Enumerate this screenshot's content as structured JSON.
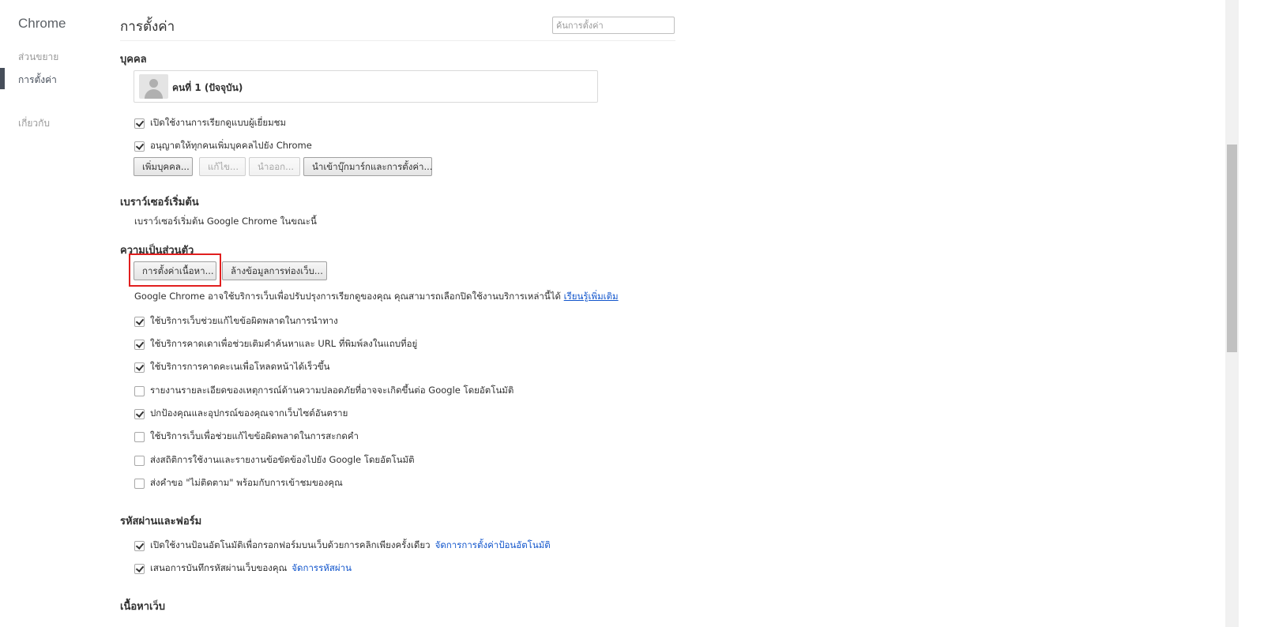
{
  "sidebar": {
    "app_title": "Chrome",
    "items": [
      {
        "label": "ส่วนขยาย"
      },
      {
        "label": "การตั้งค่า"
      },
      {
        "label": "เกี่ยวกับ"
      }
    ]
  },
  "header": {
    "title": "การตั้งค่า",
    "search_placeholder": "ค้นการตั้งค่า"
  },
  "people": {
    "title": "บุคคล",
    "profile_name": "คนที่ 1 (ปัจจุบัน)",
    "checks": [
      {
        "label": "เปิดใช้งานการเรียกดูแบบผู้เยี่ยมชม",
        "checked": true
      },
      {
        "label": "อนุญาตให้ทุกคนเพิ่มบุคคลไปยัง Chrome",
        "checked": true
      }
    ],
    "buttons": {
      "add": "เพิ่มบุคคล...",
      "edit": "แก้ไข...",
      "remove": "นำออก...",
      "import": "นำเข้าบุ๊กมาร์กและการตั้งค่า..."
    }
  },
  "default_browser": {
    "title": "เบราว์เซอร์เริ่มต้น",
    "text": "เบราว์เซอร์เริ่มต้น Google Chrome ในขณะนี้"
  },
  "privacy": {
    "title": "ความเป็นส่วนตัว",
    "content_settings_button": "การตั้งค่าเนื้อหา...",
    "clear_data_button": "ล้างข้อมูลการท่องเว็บ...",
    "description": "Google Chrome อาจใช้บริการเว็บเพื่อปรับปรุงการเรียกดูของคุณ คุณสามารถเลือกปิดใช้งานบริการเหล่านี้ได้",
    "learn_more": "เรียนรู้เพิ่มเติม",
    "checks": [
      {
        "label": "ใช้บริการเว็บช่วยแก้ไขข้อผิดพลาดในการนำทาง",
        "checked": true
      },
      {
        "label": "ใช้บริการคาดเดาเพื่อช่วยเติมคำค้นหาและ URL ที่พิมพ์ลงในแถบที่อยู่",
        "checked": true
      },
      {
        "label": "ใช้บริการการคาดคะเนเพื่อโหลดหน้าได้เร็วขึ้น",
        "checked": true
      },
      {
        "label": "รายงานรายละเอียดของเหตุการณ์ด้านความปลอดภัยที่อาจจะเกิดขึ้นต่อ Google โดยอัตโนมัติ",
        "checked": false
      },
      {
        "label": "ปกป้องคุณและอุปกรณ์ของคุณจากเว็บไซต์อันตราย",
        "checked": true
      },
      {
        "label": "ใช้บริการเว็บเพื่อช่วยแก้ไขข้อผิดพลาดในการสะกดคำ",
        "checked": false
      },
      {
        "label": "ส่งสถิติการใช้งานและรายงานข้อขัดข้องไปยัง Google โดยอัตโนมัติ",
        "checked": false
      },
      {
        "label": "ส่งคำขอ \"ไม่ติดตาม\" พร้อมกับการเข้าชมของคุณ",
        "checked": false
      }
    ]
  },
  "passwords": {
    "title": "รหัสผ่านและฟอร์ม",
    "checks": [
      {
        "label": "เปิดใช้งานป้อนอัตโนมัติเพื่อกรอกฟอร์มบนเว็บด้วยการคลิกเพียงครั้งเดียว",
        "checked": true,
        "link": "จัดการการตั้งค่าป้อนอัตโนมัติ"
      },
      {
        "label": "เสนอการบันทึกรหัสผ่านเว็บของคุณ",
        "checked": true,
        "link": "จัดการรหัสผ่าน"
      }
    ]
  },
  "web_content": {
    "title": "เนื้อหาเว็บ"
  }
}
